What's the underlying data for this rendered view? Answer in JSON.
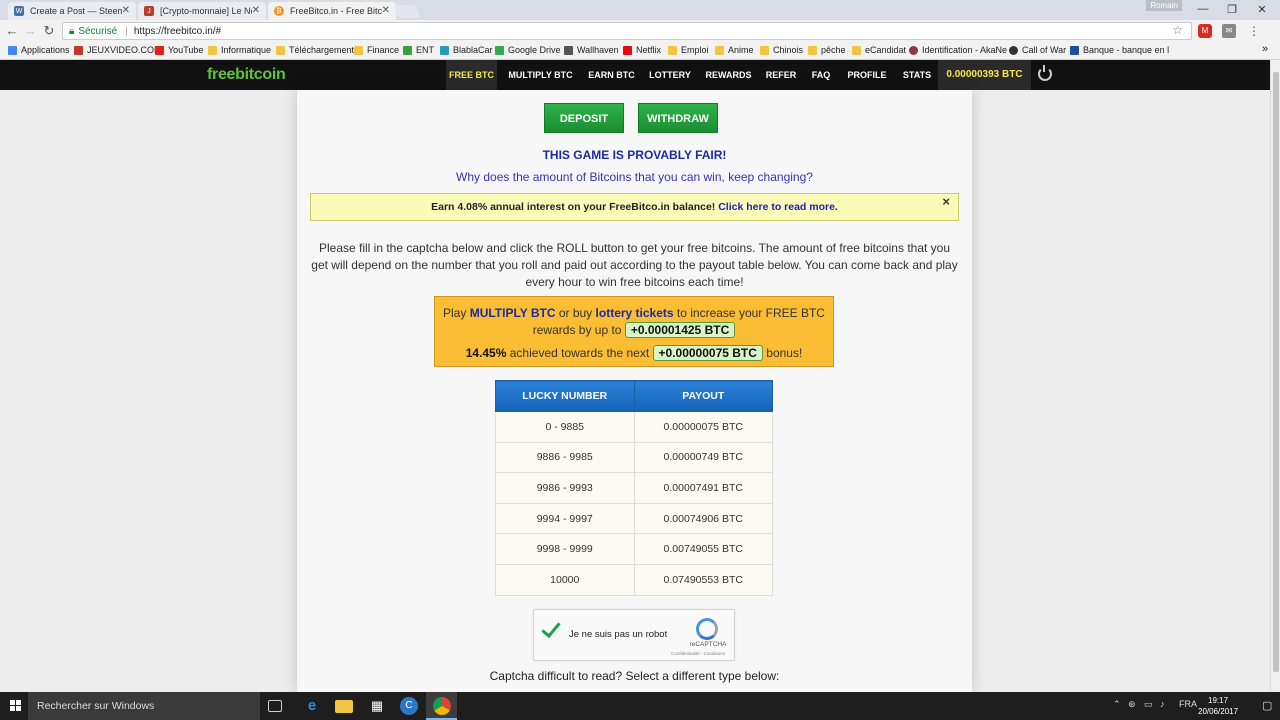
{
  "browser": {
    "tabs": [
      {
        "title": "Create a Post — Steemit",
        "favicon": "steemit",
        "color": "#4a6fa5",
        "active": false
      },
      {
        "title": "[Crypto-monnaie] Le Ne",
        "favicon": "jeuxvideo",
        "color": "#c0392b",
        "active": false
      },
      {
        "title": "FreeBitco.in - Free Bitcoi",
        "favicon": "bitcoin",
        "color": "#f7931a",
        "active": true
      }
    ],
    "user_badge": "Romain",
    "url_secure_label": "Sécurisé",
    "url": "https://freebitco.in/#",
    "bookmarks": [
      {
        "label": "Applications",
        "color": "#4285f4"
      },
      {
        "label": "JEUXVIDEO.COM",
        "color": "#c0392b"
      },
      {
        "label": "YouTube",
        "color": "#e62117"
      },
      {
        "label": "Informatique",
        "color": "#f4c542"
      },
      {
        "label": "Téléchargement",
        "color": "#f4c542"
      },
      {
        "label": "Finance",
        "color": "#f4c542"
      },
      {
        "label": "ENT",
        "color": "#3c9d3c"
      },
      {
        "label": "BlablaCar",
        "color": "#2a9bb5"
      },
      {
        "label": "Google Drive",
        "color": "#34a853"
      },
      {
        "label": "Wallhaven",
        "color": "#555555"
      },
      {
        "label": "Netflix",
        "color": "#e50914"
      },
      {
        "label": "Emploi",
        "color": "#f4c542"
      },
      {
        "label": "Anime",
        "color": "#f4c542"
      },
      {
        "label": "Chinois",
        "color": "#f4c542"
      },
      {
        "label": "pêche",
        "color": "#f4c542"
      },
      {
        "label": "eCandidat",
        "color": "#f4c542"
      },
      {
        "label": "Identification - AkaNe",
        "color": "#8b3a3a"
      },
      {
        "label": "Call of War",
        "color": "#333333"
      },
      {
        "label": "Banque - banque en l",
        "color": "#1c4e9c"
      }
    ]
  },
  "site": {
    "logo_free": "free",
    "logo_bitcoin": "bitcoin",
    "nav": [
      {
        "label": "FREE BTC",
        "active": true
      },
      {
        "label": "MULTIPLY BTC",
        "active": false
      },
      {
        "label": "EARN BTC",
        "active": false
      },
      {
        "label": "LOTTERY",
        "active": false
      },
      {
        "label": "REWARDS",
        "active": false
      },
      {
        "label": "REFER",
        "active": false
      },
      {
        "label": "FAQ",
        "active": false
      },
      {
        "label": "PROFILE",
        "active": false
      },
      {
        "label": "STATS",
        "active": false
      }
    ],
    "balance": "0.00000393 BTC"
  },
  "main": {
    "deposit_label": "DEPOSIT",
    "withdraw_label": "WITHDRAW",
    "fair_heading": "THIS GAME IS PROVABLY FAIR!",
    "why_link": "Why does the amount of Bitcoins that you can win, keep changing?",
    "interest_text": "Earn 4.08% annual interest on your FreeBitco.in balance!",
    "interest_link": "Click here to read more.",
    "close_glyph": "×",
    "instructions": "Please fill in the captcha below and click the ROLL button to get your free bitcoins. The amount of free bitcoins that you get will depend on the number that you roll and paid out according to the payout table below. You can come back and play every hour to win free bitcoins each time!",
    "promo": {
      "play": "Play",
      "multiply": "MULTIPLY BTC",
      "or_buy": "or buy",
      "lottery": "lottery tickets",
      "increase": "to increase your FREE BTC",
      "rewards_by": "rewards by up to",
      "max_bonus": "+0.00001425 BTC",
      "percent": "14.45%",
      "achieved": "achieved towards the next",
      "next_bonus": "+0.00000075 BTC",
      "bonus_word": "bonus!"
    },
    "table": {
      "headers": [
        "LUCKY NUMBER",
        "PAYOUT"
      ],
      "rows": [
        [
          "0 - 9885",
          "0.00000075 BTC"
        ],
        [
          "9886 - 9985",
          "0.00000749 BTC"
        ],
        [
          "9986 - 9993",
          "0.00007491 BTC"
        ],
        [
          "9994 - 9997",
          "0.00074906 BTC"
        ],
        [
          "9998 - 9999",
          "0.00749055 BTC"
        ],
        [
          "10000",
          "0.07490553 BTC"
        ]
      ]
    },
    "captcha": {
      "label": "Je ne suis pas un robot",
      "brand": "reCAPTCHA",
      "links": "Confidentialité - Conditions"
    },
    "captcha_difficult": "Captcha difficult to read? Select a different type below:"
  },
  "taskbar": {
    "search_placeholder": "Rechercher sur Windows",
    "language": "FRA",
    "time": "19:17",
    "date": "20/06/2017"
  }
}
